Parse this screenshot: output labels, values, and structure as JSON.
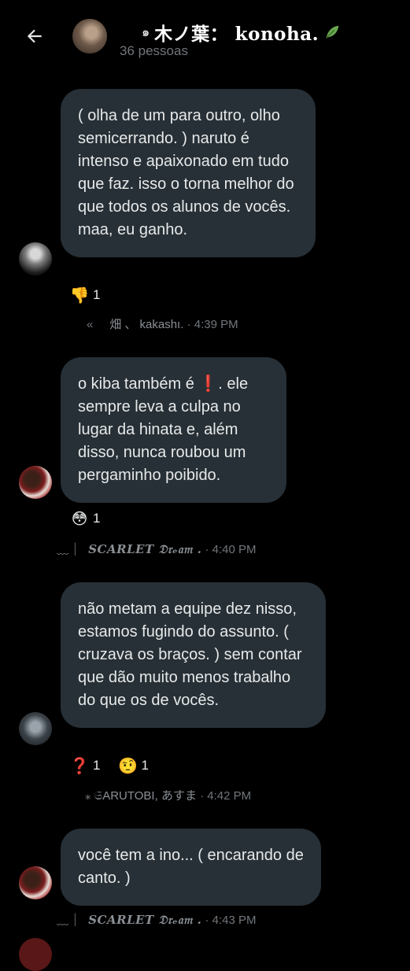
{
  "header": {
    "title": "木ノ葉： konoha.",
    "swirl": "๑",
    "members": "36 pessoas"
  },
  "messages": [
    {
      "text": "( olha de um para outro, olho semicerrando. ) naruto é intenso e apaixonado em tudo que faz. isso o torna melhor do que todos os alunos de vocês. maa, eu ganho.",
      "reactions": [
        {
          "emoji": "👎",
          "count": "1"
        }
      ],
      "sender_prefix": "«",
      "sender": "畑 、 kakashı.",
      "time": "· 4:39 PM"
    },
    {
      "text": "o kiba também é ❗. ele sempre leva a culpa no lugar da hinata e, além disso, nunca roubou um pergaminho poibido.",
      "reactions": [
        {
          "emoji": "😳",
          "count": "1"
        }
      ],
      "sender_prefix": "﹏ ⏐",
      "sender": "SCARLET 𝔇𝔯ₑ𝔞𝔪 .",
      "time": "· 4:40 PM"
    },
    {
      "text": "não metam a equipe dez nisso, estamos fugindo do assunto. ( cruzava os braços. ) sem contar que dão muito menos trabalho do que os de vocês.",
      "reactions": [
        {
          "emoji": "❓",
          "count": "1"
        },
        {
          "emoji": "🤨",
          "count": "1"
        }
      ],
      "sender_prefix": "⁎",
      "sender": "𝔖ARUTOBI, あすま",
      "time": "· 4:42 PM"
    },
    {
      "text": "você tem a ino... ( encarando de canto. )",
      "reactions": [],
      "sender_prefix": "﹏ ⏐",
      "sender": "SCARLET 𝔇𝔯ₑ𝔞𝔪 .",
      "time": "· 4:43 PM"
    }
  ]
}
